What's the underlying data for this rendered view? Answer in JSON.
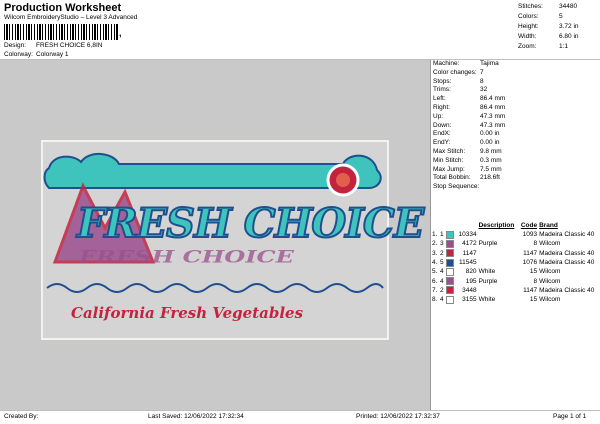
{
  "header": {
    "title": "Production Worksheet",
    "subtitle": "Wilcom EmbroideryStudio – Level 3 Advanced",
    "barcode_tick": ",",
    "design_label": "Design:",
    "design_value": "FRESH CHOICE 6,8IN",
    "colorway_label": "Colorway:",
    "colorway_value": "Colorway 1"
  },
  "stats": [
    {
      "label": "Stitches:",
      "value": "34480"
    },
    {
      "label": "Colors:",
      "value": "5"
    },
    {
      "label": "Height:",
      "value": "3.72 in"
    },
    {
      "label": "Width:",
      "value": "6.80 in"
    },
    {
      "label": "Zoom:",
      "value": "1:1"
    }
  ],
  "properties": [
    {
      "label": "Machine:",
      "value": "Tajima"
    },
    {
      "label": "Color changes:",
      "value": "7"
    },
    {
      "label": "Stops:",
      "value": "8"
    },
    {
      "label": "Trims:",
      "value": "32"
    },
    {
      "label": "Left:",
      "value": "86.4 mm"
    },
    {
      "label": "Right:",
      "value": "86.4 mm"
    },
    {
      "label": "Up:",
      "value": "47.3 mm"
    },
    {
      "label": "Down:",
      "value": "47.3 mm"
    },
    {
      "label": "EndX:",
      "value": "0.00 in"
    },
    {
      "label": "EndY:",
      "value": "0.00 in"
    },
    {
      "label": "Max Stitch:",
      "value": "9.8 mm"
    },
    {
      "label": "Min Stitch:",
      "value": "0.3 mm"
    },
    {
      "label": "Max Jump:",
      "value": "7.5 mm"
    },
    {
      "label": "Total Bobbin:",
      "value": "218.6ft"
    }
  ],
  "stop_sequence": {
    "title": "Stop Sequence:",
    "headers": {
      "n": "",
      "stop": "",
      "swatch": "",
      "code": "",
      "description": "Description",
      "code2": "Code",
      "brand": "Brand"
    },
    "rows": [
      {
        "n": "1.",
        "stop": "1",
        "color": "#3ec4bd",
        "code": "10334",
        "description": "",
        "code2": "1093",
        "brand": "Madeira Classic 40"
      },
      {
        "n": "2.",
        "stop": "3",
        "color": "#9b4f8e",
        "code": "4172",
        "description": "Purple",
        "code2": "8",
        "brand": "Wilcom"
      },
      {
        "n": "3.",
        "stop": "2",
        "color": "#c4233f",
        "code": "1147",
        "description": "",
        "code2": "1147",
        "brand": "Madeira Classic 40"
      },
      {
        "n": "4.",
        "stop": "5",
        "color": "#1e4f8f",
        "code": "11545",
        "description": "",
        "code2": "1076",
        "brand": "Madeira Classic 40"
      },
      {
        "n": "5.",
        "stop": "4",
        "color": "#ffffff",
        "code": "820",
        "description": "White",
        "code2": "15",
        "brand": "Wilcom"
      },
      {
        "n": "6.",
        "stop": "4",
        "color": "#9b4f8e",
        "code": "195",
        "description": "Purple",
        "code2": "8",
        "brand": "Wilcom"
      },
      {
        "n": "7.",
        "stop": "2",
        "color": "#c4233f",
        "code": "3448",
        "description": "",
        "code2": "1147",
        "brand": "Madeira Classic 40"
      },
      {
        "n": "8.",
        "stop": "4",
        "color": "#ffffff",
        "code": "3155",
        "description": "White",
        "code2": "15",
        "brand": "Wilcom"
      }
    ]
  },
  "design_text": {
    "main": "FRESH CHOICE",
    "shadow": "FRESH CHOICE",
    "tagline": "California Fresh Vegetables"
  },
  "colors": {
    "teal": "#3ec4bd",
    "navy": "#1e4f8f",
    "purple": "#9b4f8e",
    "red": "#c4233f",
    "canvas": "#c9c9c9"
  },
  "footer": {
    "created_by": "Created By:",
    "last_saved": "Last Saved: 12/06/2022 17:32:34",
    "printed": "Printed: 12/06/2022 17:32:37",
    "page": "Page 1 of 1"
  }
}
